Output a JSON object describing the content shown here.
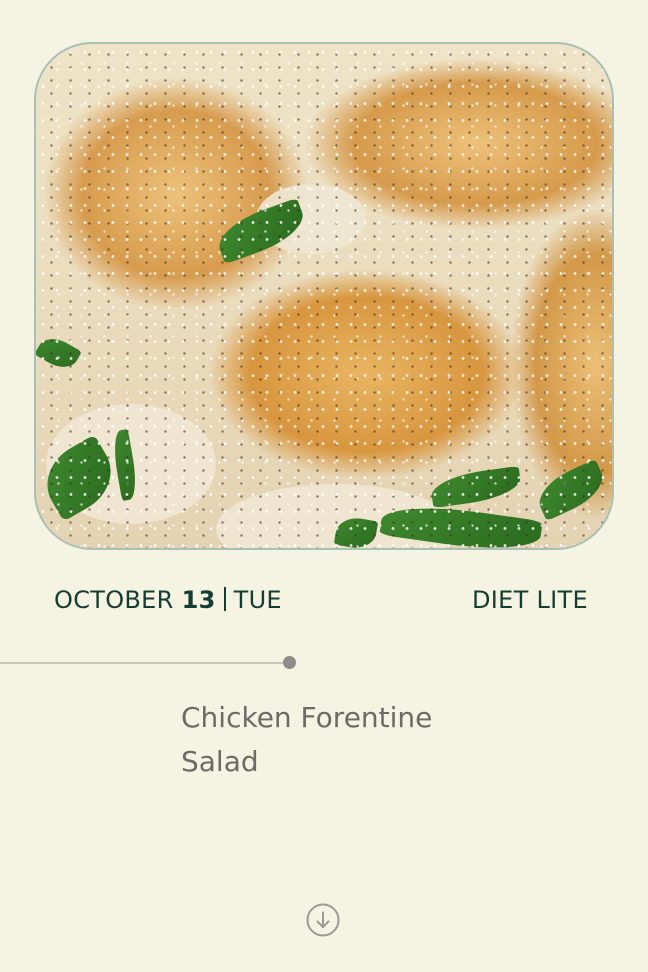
{
  "hero": {
    "image_alt": "Chicken Forentine Salad"
  },
  "date": {
    "month": "OCTOBER",
    "day": "13",
    "weekday": "TUE"
  },
  "plan": {
    "label": "DIET LITE"
  },
  "meal": {
    "title_line1": "Chicken Forentine",
    "title_line2": "Salad"
  },
  "icons": {
    "scroll": "arrow-down-circle-icon"
  },
  "colors": {
    "background": "#f5f3e1",
    "accent_text": "#143d34",
    "muted_text": "#6b6b68",
    "card_border": "#a9c0b6",
    "timeline_dot": "#8e8d88"
  }
}
